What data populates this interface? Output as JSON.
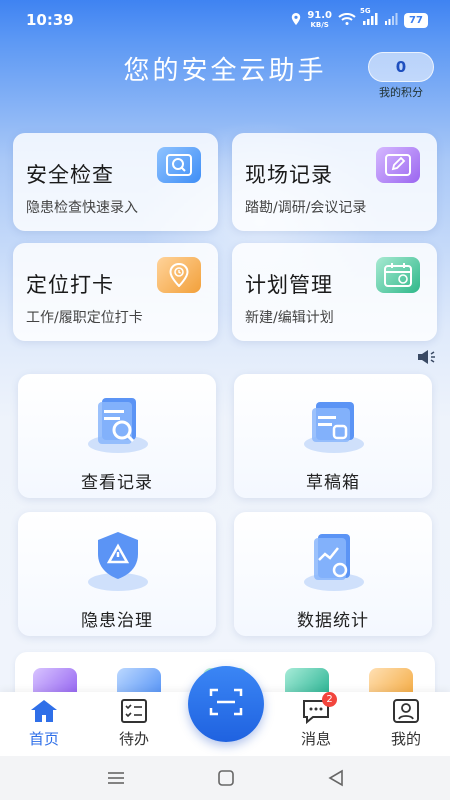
{
  "status_bar": {
    "time": "10:39",
    "speed_value": "91.0",
    "speed_unit": "KB/S",
    "network": "5G",
    "battery": "77"
  },
  "header": {
    "title": "您的安全云助手",
    "points_value": "0",
    "points_label": "我的积分"
  },
  "quick_cards": [
    {
      "title": "安全检查",
      "subtitle": "隐患检查快速录入",
      "icon": "search-icon"
    },
    {
      "title": "现场记录",
      "subtitle": "踏勘/调研/会议记录",
      "icon": "edit-icon"
    },
    {
      "title": "定位打卡",
      "subtitle": "工作/履职定位打卡",
      "icon": "location-clock-icon"
    },
    {
      "title": "计划管理",
      "subtitle": "新建/编辑计划",
      "icon": "calendar-icon"
    }
  ],
  "tiles": [
    {
      "label": "查看记录",
      "icon": "records-icon"
    },
    {
      "label": "草稿箱",
      "icon": "drafts-icon"
    },
    {
      "label": "隐患治理",
      "icon": "hazard-shield-icon"
    },
    {
      "label": "数据统计",
      "icon": "statistics-icon"
    }
  ],
  "bottom_nav": {
    "items": [
      {
        "label": "首页",
        "icon": "home-icon",
        "active": true
      },
      {
        "label": "待办",
        "icon": "todo-icon",
        "active": false
      },
      {
        "label": "消息",
        "icon": "message-icon",
        "active": false,
        "badge": "2"
      },
      {
        "label": "我的",
        "icon": "profile-icon",
        "active": false
      }
    ],
    "scan_icon": "scan-icon"
  },
  "colors": {
    "accent": "#2f6fe8",
    "header_blue": "#3f83f2",
    "badge_red": "#f2453d"
  }
}
